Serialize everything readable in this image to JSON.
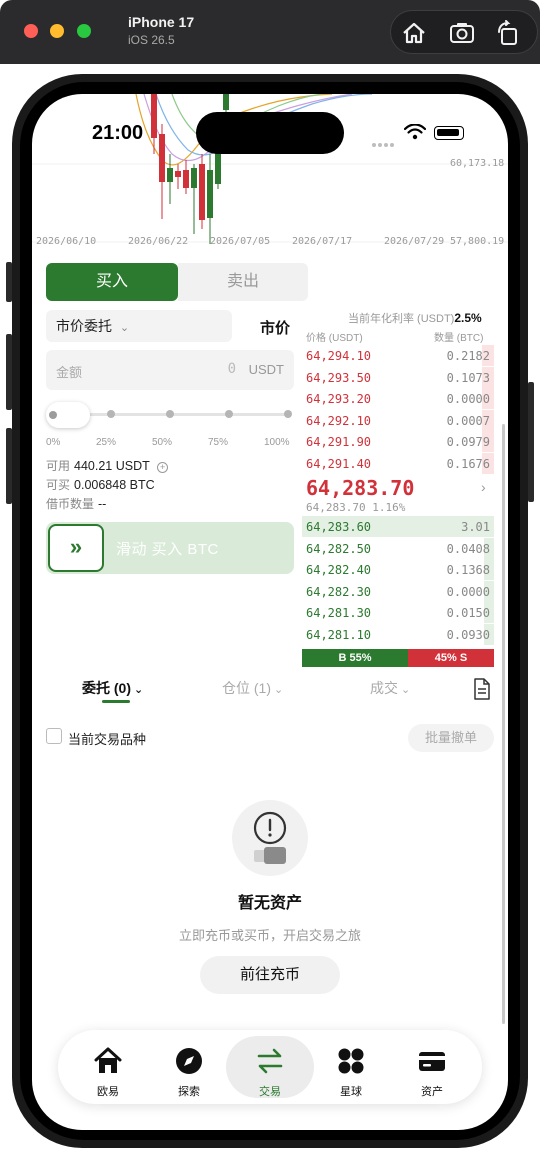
{
  "simulator": {
    "device_name": "iPhone 17",
    "os_version": "iOS 26.5",
    "toolbar_icons": [
      "home-icon",
      "screenshot-icon",
      "rotate-icon"
    ]
  },
  "status_bar": {
    "time": "21:00"
  },
  "chart": {
    "price_high_label": "60,173.18",
    "price_low_label": "57,800.19",
    "date_labels": [
      "2026/06/10",
      "2026/06/22",
      "2026/07/05",
      "2026/07/17",
      "2026/07/29"
    ]
  },
  "trade_form": {
    "buy_tab": "买入",
    "sell_tab": "卖出",
    "order_type": "市价委托",
    "price_mode": "市价",
    "amount_placeholder": "金额",
    "amount_value": "0",
    "amount_unit": "USDT",
    "slider_percent": 0,
    "slider_marks": [
      "0%",
      "25%",
      "50%",
      "75%",
      "100%"
    ],
    "available_label": "可用",
    "available_value": "440.21 USDT",
    "can_buy_label": "可买",
    "can_buy_value": "0.006848 BTC",
    "borrow_label": "借币数量",
    "borrow_value": "--",
    "swipe_text": "滑动 买入 BTC"
  },
  "order_book": {
    "rate_label": "当前年化利率 (USDT)",
    "rate_value": "2.5%",
    "price_header": "价格 (USDT)",
    "qty_header": "数量 (BTC)",
    "asks": [
      {
        "price": "64,294.10",
        "qty": "0.2182",
        "depth": 0.06
      },
      {
        "price": "64,293.50",
        "qty": "0.1073",
        "depth": 0.06
      },
      {
        "price": "64,293.20",
        "qty": "0.0000",
        "depth": 0.06
      },
      {
        "price": "64,292.10",
        "qty": "0.0007",
        "depth": 0.06
      },
      {
        "price": "64,291.90",
        "qty": "0.0979",
        "depth": 0.06
      },
      {
        "price": "64,291.40",
        "qty": "0.1676",
        "depth": 0.06
      }
    ],
    "last_price": "64,283.70",
    "last_sub": "64,283.70 1.16%",
    "bids": [
      {
        "price": "64,283.60",
        "qty": "3.01",
        "depth": 1.0
      },
      {
        "price": "64,282.50",
        "qty": "0.0408",
        "depth": 0.05
      },
      {
        "price": "64,282.40",
        "qty": "0.1368",
        "depth": 0.05
      },
      {
        "price": "64,282.30",
        "qty": "0.0000",
        "depth": 0.05
      },
      {
        "price": "64,281.30",
        "qty": "0.0150",
        "depth": 0.05
      },
      {
        "price": "64,281.10",
        "qty": "0.0930",
        "depth": 0.05
      }
    ],
    "buy_ratio_label": "B 55%",
    "sell_ratio_label": "45% S",
    "buy_ratio": 0.55
  },
  "orders": {
    "tabs": [
      "委托 (0)",
      "仓位 (1)",
      "成交"
    ],
    "current_pair_filter": "当前交易品种",
    "batch_cancel": "批量撤单",
    "empty_title": "暂无资产",
    "empty_subtitle": "立即充币或买币，开启交易之旅",
    "deposit_button": "前往充币"
  },
  "tab_bar": {
    "items": [
      {
        "label": "欧易",
        "icon": "home-icon"
      },
      {
        "label": "探索",
        "icon": "compass-icon"
      },
      {
        "label": "交易",
        "icon": "trade-arrows-icon"
      },
      {
        "label": "星球",
        "icon": "grid-dots-icon"
      },
      {
        "label": "资产",
        "icon": "wallet-card-icon"
      }
    ],
    "active": "交易"
  },
  "colors": {
    "buy_green": "#2c7a2f",
    "sell_red": "#d1323a"
  }
}
